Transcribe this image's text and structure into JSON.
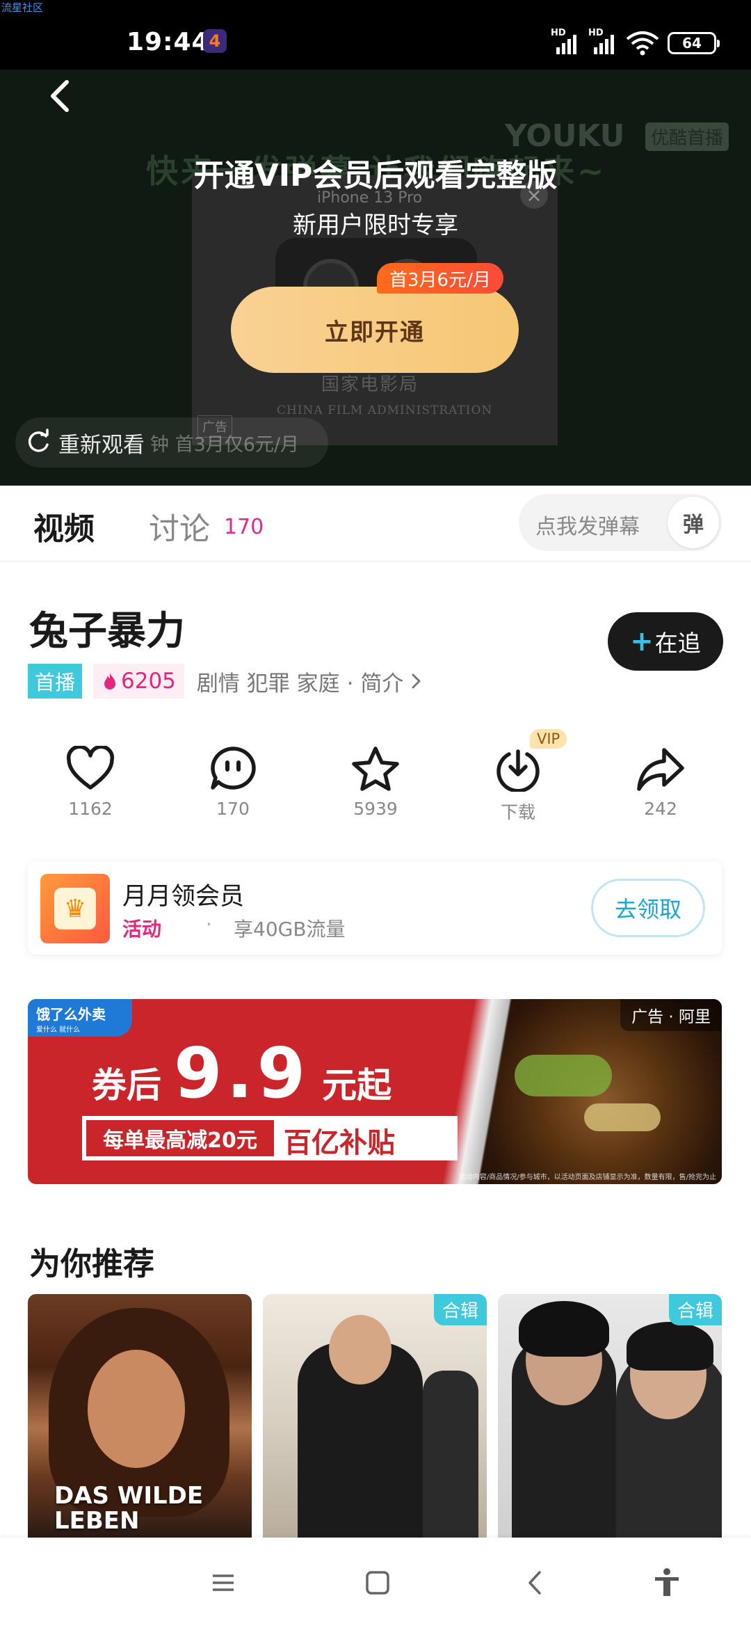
{
  "status_bar": {
    "watermark": "流星社区",
    "time": "19:44",
    "signal_1_label": "HD",
    "signal_2_label": "HD",
    "battery": "64"
  },
  "video": {
    "background_text": "快来一发弹幕  让我们嗨起来~",
    "brand": "YOUKU",
    "brand_tag": "优酷首播",
    "inner_ad_product": "iPhone 13 Pro",
    "inner_ad_tag": "广告",
    "film_admin_cn": "国家电影局",
    "film_admin_en": "CHINA FILM ADMINISTRATION",
    "vip_title": "开通VIP会员后观看完整版",
    "vip_subtitle": "新用户限时专享",
    "vip_button": "立即开通",
    "price_badge": "首3月6元/月",
    "replay_label": "重新观看",
    "replay_tail": "钟 首3月仅6元/月"
  },
  "tabs": {
    "video": "视频",
    "discuss": "讨论",
    "discuss_count": "170",
    "danmaku_placeholder": "点我发弹幕",
    "danmaku_switch": "弹"
  },
  "show": {
    "title": "兔子暴力",
    "follow_label": "在追",
    "premiere": "首播",
    "heat": "6205",
    "genres": "剧情 犯罪 家庭",
    "intro": "· 简介"
  },
  "actions": [
    {
      "icon": "heart-icon",
      "count": "1162"
    },
    {
      "icon": "comment-icon",
      "count": "170"
    },
    {
      "icon": "star-icon",
      "count": "5939"
    },
    {
      "icon": "download-icon",
      "count": "下载",
      "badge": "VIP"
    },
    {
      "icon": "share-icon",
      "count": "242"
    }
  ],
  "promo": {
    "title": "月月领会员",
    "tag": "活动",
    "separator": "·",
    "desc": "享40GB流量",
    "button": "去领取"
  },
  "ad_banner": {
    "logo": "饿了么外卖",
    "logo_sub": "爱什么 就什么",
    "ad_label": "广告 · 阿里",
    "line1_a": "券后",
    "line1_b": "9.9",
    "line1_c": "元起",
    "strip_1": "每单最高减20元",
    "strip_2": "百亿补贴",
    "fine_print": "活动内容/商品情况/参与城市，以活动页面及店铺显示为准，数量有限，售/抢完为止"
  },
  "recommend": {
    "title": "为你推荐",
    "cards": [
      {
        "poster_text": "DAS WILDE LEBEN",
        "badge": ""
      },
      {
        "poster_text": "",
        "badge": "合辑"
      },
      {
        "poster_text": "",
        "badge": "合辑"
      }
    ]
  },
  "colors": {
    "accent_cyan": "#3ec9dd",
    "accent_pink": "#e0287d",
    "vip_gold": "#f6c774"
  }
}
